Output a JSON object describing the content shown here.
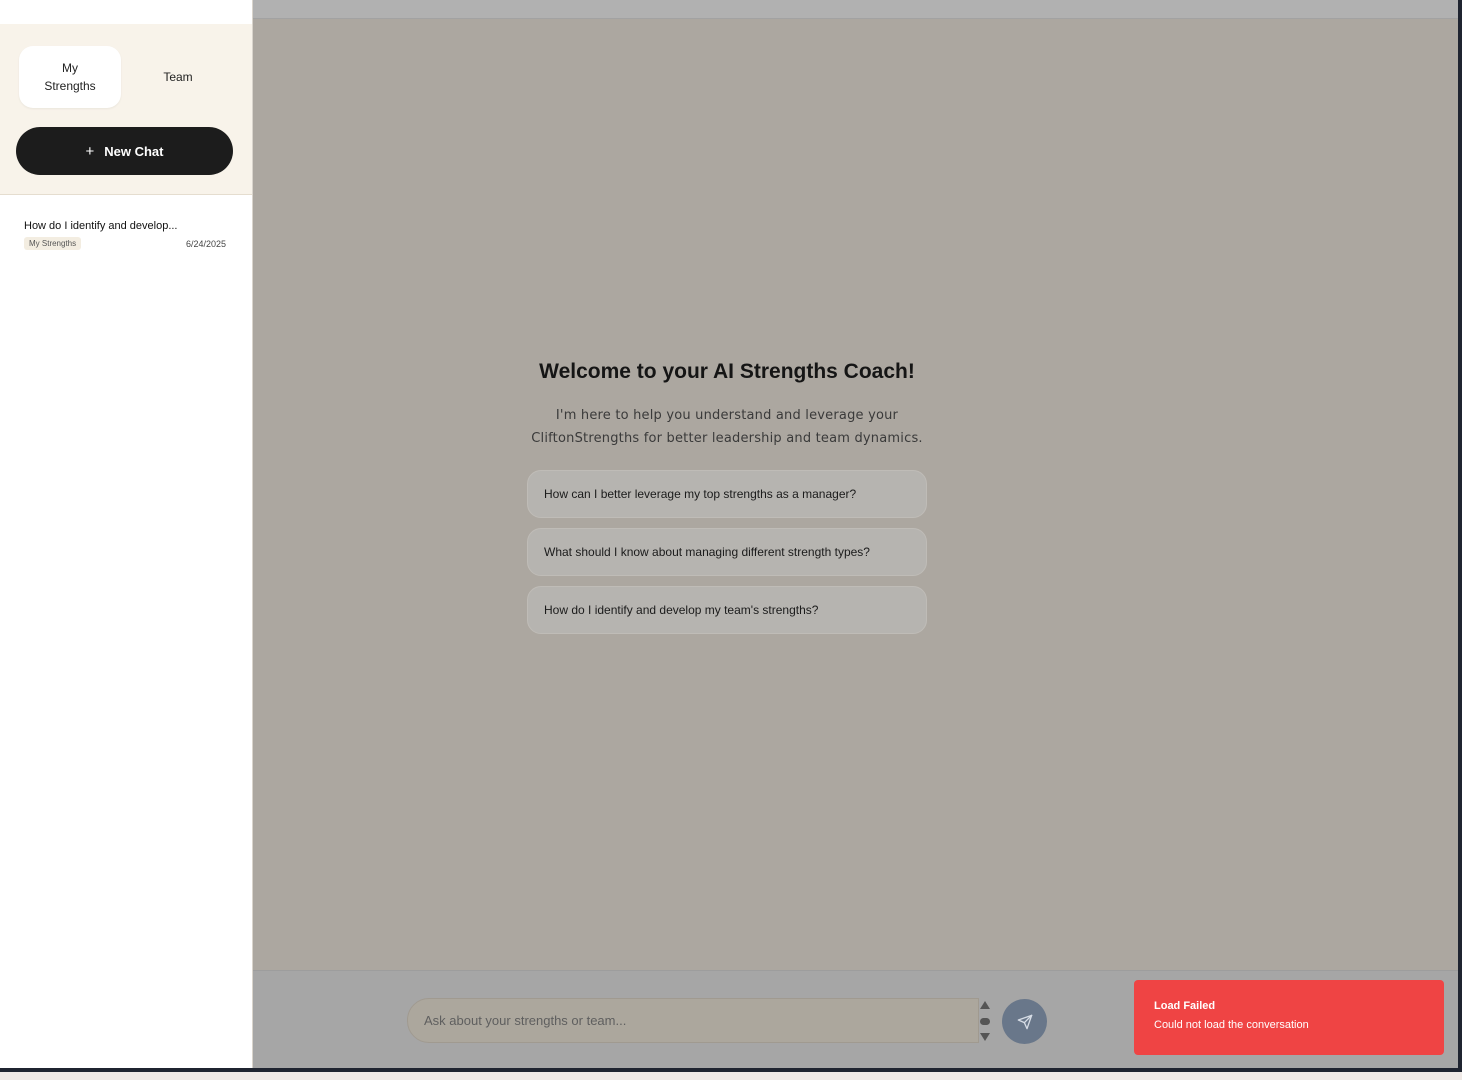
{
  "sidebar": {
    "tabs": [
      {
        "label": "My Strengths",
        "active": true
      },
      {
        "label": "Team",
        "active": false
      }
    ],
    "new_chat": {
      "icon": "plus-icon",
      "label": "New Chat"
    },
    "chats": [
      {
        "title": "How do I identify and develop...",
        "badge": "My Strengths",
        "date": "6/24/2025"
      }
    ]
  },
  "main": {
    "welcome_title": "Welcome to your AI Strengths Coach!",
    "welcome_text": "I'm here to help you understand and leverage your CliftonStrengths for better leadership and team dynamics.",
    "suggestions": [
      "How can I better leverage my top strengths as a manager?",
      "What should I know about managing different strength types?",
      "How do I identify and develop my team's strengths?"
    ],
    "input": {
      "placeholder": "Ask about your strengths or team..."
    },
    "send_icon": "send-icon"
  },
  "toast": {
    "title": "Load Failed",
    "message": "Could not load the conversation",
    "color": "#ef4444"
  }
}
